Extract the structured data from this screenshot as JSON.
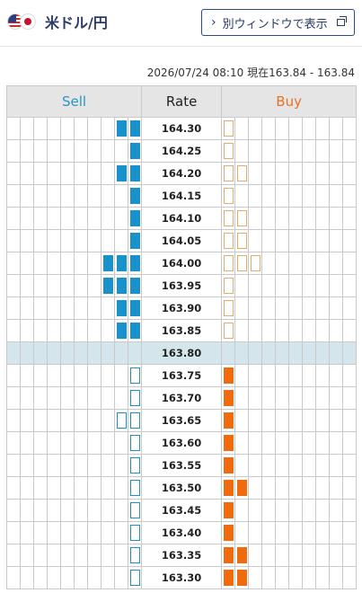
{
  "pair": {
    "title": "米ドル/円",
    "flags": [
      "us-flag-icon",
      "jp-flag-icon"
    ]
  },
  "window_button": {
    "chevron": "›",
    "label": "別ウィンドウで表示",
    "icon": "popout-icon"
  },
  "timestamp": "2026/07/24 08:10 現在163.84 - 163.84",
  "table": {
    "headers": {
      "sell": "Sell",
      "rate": "Rate",
      "buy": "Buy"
    },
    "sell_cols": 10,
    "buy_cols": 10,
    "rows": [
      {
        "rate": "164.30",
        "sell": 2,
        "buy": 1,
        "filled": "sell"
      },
      {
        "rate": "164.25",
        "sell": 1,
        "buy": 1,
        "filled": "sell"
      },
      {
        "rate": "164.20",
        "sell": 2,
        "buy": 2,
        "filled": "sell"
      },
      {
        "rate": "164.15",
        "sell": 1,
        "buy": 1,
        "filled": "sell"
      },
      {
        "rate": "164.10",
        "sell": 1,
        "buy": 2,
        "filled": "sell"
      },
      {
        "rate": "164.05",
        "sell": 1,
        "buy": 2,
        "filled": "sell"
      },
      {
        "rate": "164.00",
        "sell": 3,
        "buy": 3,
        "filled": "sell"
      },
      {
        "rate": "163.95",
        "sell": 3,
        "buy": 1,
        "filled": "sell"
      },
      {
        "rate": "163.90",
        "sell": 2,
        "buy": 1,
        "filled": "sell"
      },
      {
        "rate": "163.85",
        "sell": 2,
        "buy": 1,
        "filled": "sell"
      },
      {
        "rate": "163.80",
        "sell": 0,
        "buy": 0,
        "filled": "none",
        "current": true
      },
      {
        "rate": "163.75",
        "sell": 1,
        "buy": 1,
        "filled": "buy"
      },
      {
        "rate": "163.70",
        "sell": 1,
        "buy": 1,
        "filled": "buy"
      },
      {
        "rate": "163.65",
        "sell": 2,
        "buy": 1,
        "filled": "buy"
      },
      {
        "rate": "163.60",
        "sell": 1,
        "buy": 1,
        "filled": "buy"
      },
      {
        "rate": "163.55",
        "sell": 1,
        "buy": 1,
        "filled": "buy"
      },
      {
        "rate": "163.50",
        "sell": 1,
        "buy": 2,
        "filled": "buy"
      },
      {
        "rate": "163.45",
        "sell": 1,
        "buy": 1,
        "filled": "buy"
      },
      {
        "rate": "163.40",
        "sell": 1,
        "buy": 1,
        "filled": "buy"
      },
      {
        "rate": "163.35",
        "sell": 1,
        "buy": 2,
        "filled": "buy"
      },
      {
        "rate": "163.30",
        "sell": 1,
        "buy": 2,
        "filled": "buy"
      }
    ]
  },
  "colors": {
    "sell": "#1992cc",
    "buy": "#f06a0e",
    "current_row": "#d4e6ec"
  }
}
